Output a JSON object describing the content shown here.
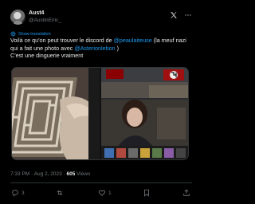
{
  "author": {
    "name": "Aust4",
    "handle": "@AustinEiric_"
  },
  "translate_label": "Show translation",
  "body": {
    "line1_pre": "Voilà ce qu'on peut trouver le discord de ",
    "mention1": "@peaulaiteuse",
    "line1_post": " (la meuf nazi qui a fait une photo avec ",
    "mention2": "@Asterionlebon",
    "line2_post": " )",
    "line3": "C'est une dinguerie vraiment"
  },
  "meta": {
    "time": "7:33 PM · Aug 2, 2023 · ",
    "views_count": "605",
    "views_label": " Views"
  },
  "actions": {
    "replies": "3",
    "retweets": "",
    "likes": "1",
    "bookmarks": ""
  },
  "icons": {
    "x_logo": "x-logo-icon",
    "more": "more-dots-icon",
    "translate": "globe-icon",
    "reply": "reply-icon",
    "retweet": "retweet-icon",
    "like": "heart-icon",
    "bookmark": "bookmark-icon",
    "share": "share-icon"
  },
  "colors": {
    "accent": "#1d9bf0",
    "background": "#000000",
    "text": "#e7e9ea",
    "muted": "#71767b"
  }
}
